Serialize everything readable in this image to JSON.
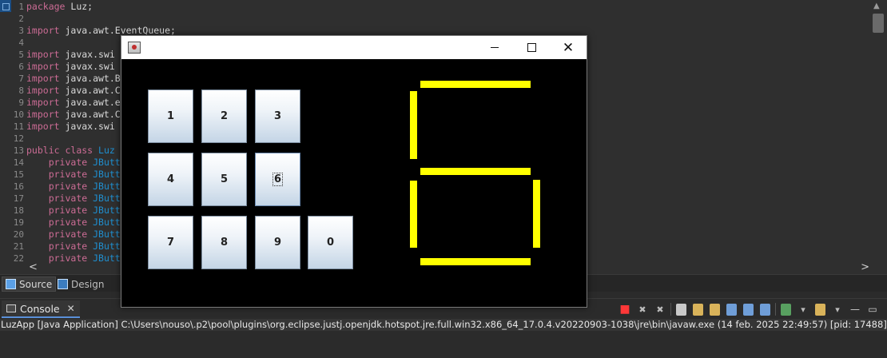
{
  "editor": {
    "lines": [
      {
        "n": "1",
        "t": [
          [
            "kw",
            "package"
          ],
          [
            "",
            " Luz;"
          ]
        ]
      },
      {
        "n": "2",
        "t": []
      },
      {
        "n": "3",
        "t": [
          [
            "kw",
            "import"
          ],
          [
            "",
            " java.awt.EventQueue;"
          ]
        ]
      },
      {
        "n": "4",
        "t": []
      },
      {
        "n": "5",
        "t": [
          [
            "kw",
            "import"
          ],
          [
            "",
            " javax.swi"
          ]
        ]
      },
      {
        "n": "6",
        "t": [
          [
            "kw",
            "import"
          ],
          [
            "",
            " javax.swi"
          ]
        ]
      },
      {
        "n": "7",
        "t": [
          [
            "kw",
            "import"
          ],
          [
            "",
            " java.awt.B"
          ]
        ]
      },
      {
        "n": "8",
        "t": [
          [
            "kw",
            "import"
          ],
          [
            "",
            " java.awt.C"
          ]
        ]
      },
      {
        "n": "9",
        "t": [
          [
            "kw",
            "import"
          ],
          [
            "",
            " java.awt.e"
          ]
        ]
      },
      {
        "n": "10",
        "t": [
          [
            "kw",
            "import"
          ],
          [
            "",
            " java.awt.C"
          ]
        ]
      },
      {
        "n": "11",
        "t": [
          [
            "kw",
            "import"
          ],
          [
            "",
            " javax.swi"
          ]
        ]
      },
      {
        "n": "12",
        "t": []
      },
      {
        "n": "13",
        "t": [
          [
            "kw",
            "public"
          ],
          [
            "",
            " "
          ],
          [
            "kw",
            "class"
          ],
          [
            "",
            " "
          ],
          [
            "ty",
            "Luz"
          ]
        ]
      },
      {
        "n": "14",
        "t": [
          [
            "",
            "    "
          ],
          [
            "kw",
            "private"
          ],
          [
            "",
            " "
          ],
          [
            "ty",
            "JButt"
          ]
        ]
      },
      {
        "n": "15",
        "t": [
          [
            "",
            "    "
          ],
          [
            "kw",
            "private"
          ],
          [
            "",
            " "
          ],
          [
            "ty",
            "JButt"
          ]
        ]
      },
      {
        "n": "16",
        "t": [
          [
            "",
            "    "
          ],
          [
            "kw",
            "private"
          ],
          [
            "",
            " "
          ],
          [
            "ty",
            "JButt"
          ]
        ]
      },
      {
        "n": "17",
        "t": [
          [
            "",
            "    "
          ],
          [
            "kw",
            "private"
          ],
          [
            "",
            " "
          ],
          [
            "ty",
            "JButt"
          ]
        ]
      },
      {
        "n": "18",
        "t": [
          [
            "",
            "    "
          ],
          [
            "kw",
            "private"
          ],
          [
            "",
            " "
          ],
          [
            "ty",
            "JButt"
          ]
        ]
      },
      {
        "n": "19",
        "t": [
          [
            "",
            "    "
          ],
          [
            "kw",
            "private"
          ],
          [
            "",
            " "
          ],
          [
            "ty",
            "JButt"
          ]
        ]
      },
      {
        "n": "20",
        "t": [
          [
            "",
            "    "
          ],
          [
            "kw",
            "private"
          ],
          [
            "",
            " "
          ],
          [
            "ty",
            "JButt"
          ]
        ]
      },
      {
        "n": "21",
        "t": [
          [
            "",
            "    "
          ],
          [
            "kw",
            "private"
          ],
          [
            "",
            " "
          ],
          [
            "ty",
            "JButt"
          ]
        ]
      },
      {
        "n": "22",
        "t": [
          [
            "",
            "    "
          ],
          [
            "kw",
            "private"
          ],
          [
            "",
            " "
          ],
          [
            "ty",
            "JButt"
          ]
        ]
      }
    ]
  },
  "tabs": {
    "source": "Source",
    "design": "Design"
  },
  "console": {
    "tab_label": "Console",
    "output": "LuzApp [Java Application] C:\\Users\\nouso\\.p2\\pool\\plugins\\org.eclipse.justj.openjdk.hotspot.jre.full.win32.x86_64_17.0.4.v20220903-1038\\jre\\bin\\javaw.exe  (14 feb. 2025 22:49:57) [pid: 17488]"
  },
  "app": {
    "keys": [
      "1",
      "2",
      "3",
      "4",
      "5",
      "6",
      "7",
      "8",
      "9",
      "0"
    ],
    "focused_key": "6",
    "display": {
      "digit": "6",
      "color": "#ffff00",
      "segments_on": [
        "a",
        "c",
        "d",
        "e",
        "f",
        "g"
      ]
    }
  }
}
